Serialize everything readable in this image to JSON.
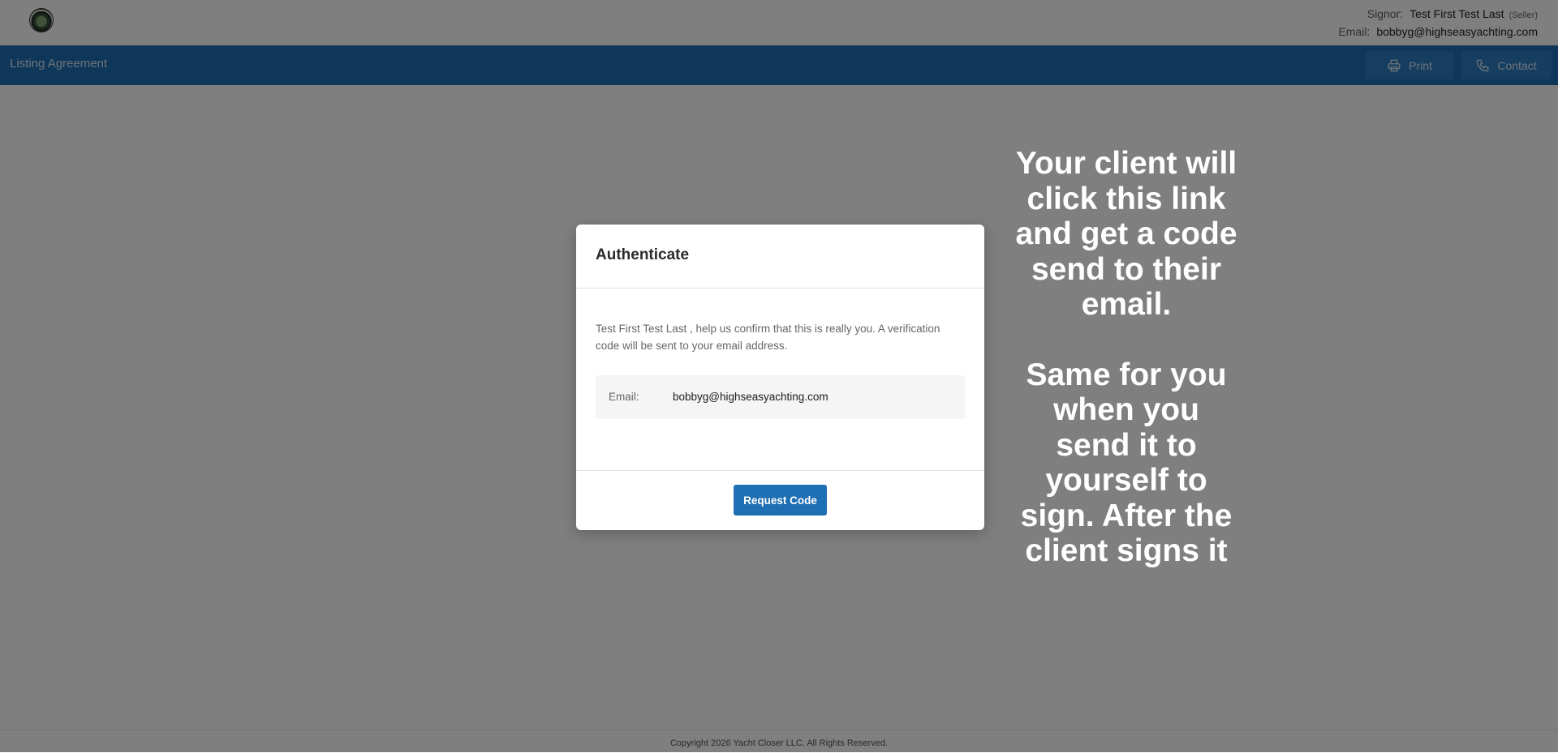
{
  "header": {
    "logo_icon": "yacht-closer-logo",
    "signor_label": "Signor:",
    "signor_name": "Test First Test Last",
    "signor_role": "(Seller)",
    "email_label": "Email:",
    "email_value": "bobbyg@highseasyachting.com"
  },
  "toolbar": {
    "document_title": "Listing Agreement",
    "print_label": "Print",
    "print_icon": "printer-icon",
    "contact_label": "Contact",
    "contact_icon": "phone-icon"
  },
  "modal": {
    "title": "Authenticate",
    "message": "Test First Test Last , help us confirm that this is really you. A verification code will be sent to your email address.",
    "email_label": "Email:",
    "email_value": "bobbyg@highseasyachting.com",
    "request_button_label": "Request Code"
  },
  "annotation": {
    "line1": "Your client will click this link and get a code send to their email.",
    "line2": "Same for you when you send it to yourself to sign. After the client signs it"
  },
  "footer": {
    "copyright": "Copyright 2026 Yacht Closer LLC. All Rights Reserved."
  },
  "colors": {
    "brand_blue": "#1f6fb4",
    "overlay": "rgba(0,0,0,0.5)"
  }
}
